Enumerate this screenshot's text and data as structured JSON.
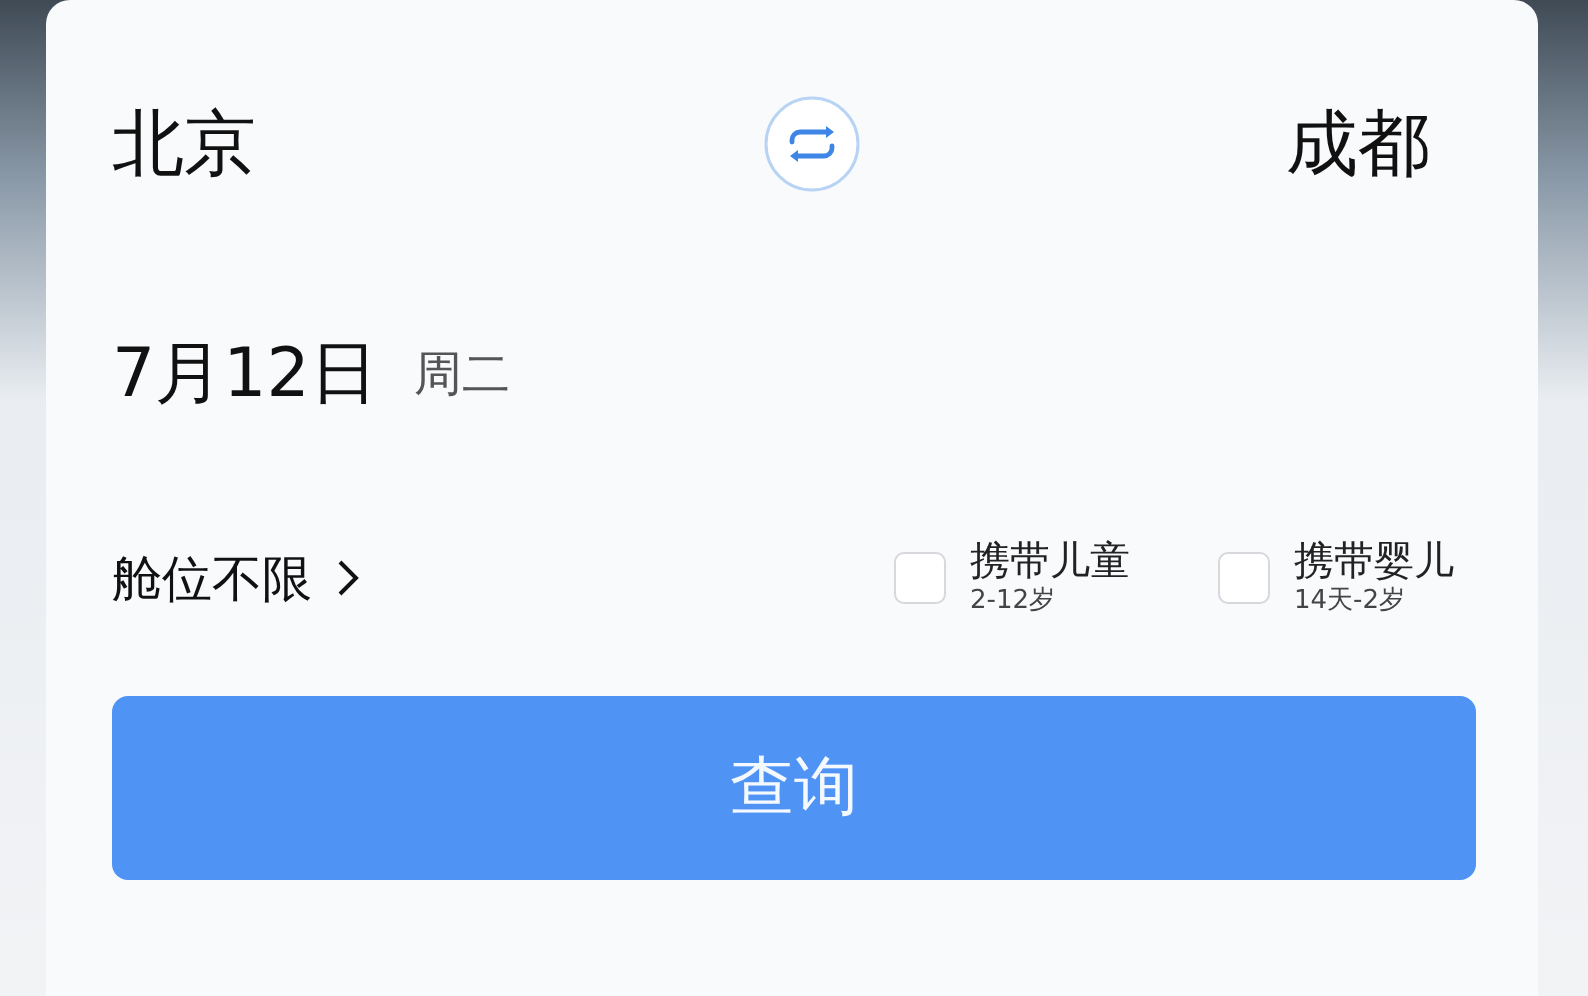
{
  "route": {
    "from": "北京",
    "to": "成都"
  },
  "date": {
    "day": "7月12日",
    "weekday": "周二"
  },
  "cabin": {
    "label": "舱位不限"
  },
  "options": [
    {
      "label": "携带儿童",
      "note": "2-12岁",
      "checked": false
    },
    {
      "label": "携带婴儿",
      "note": "14天-2岁",
      "checked": false
    }
  ],
  "search_button": {
    "label": "查询"
  }
}
